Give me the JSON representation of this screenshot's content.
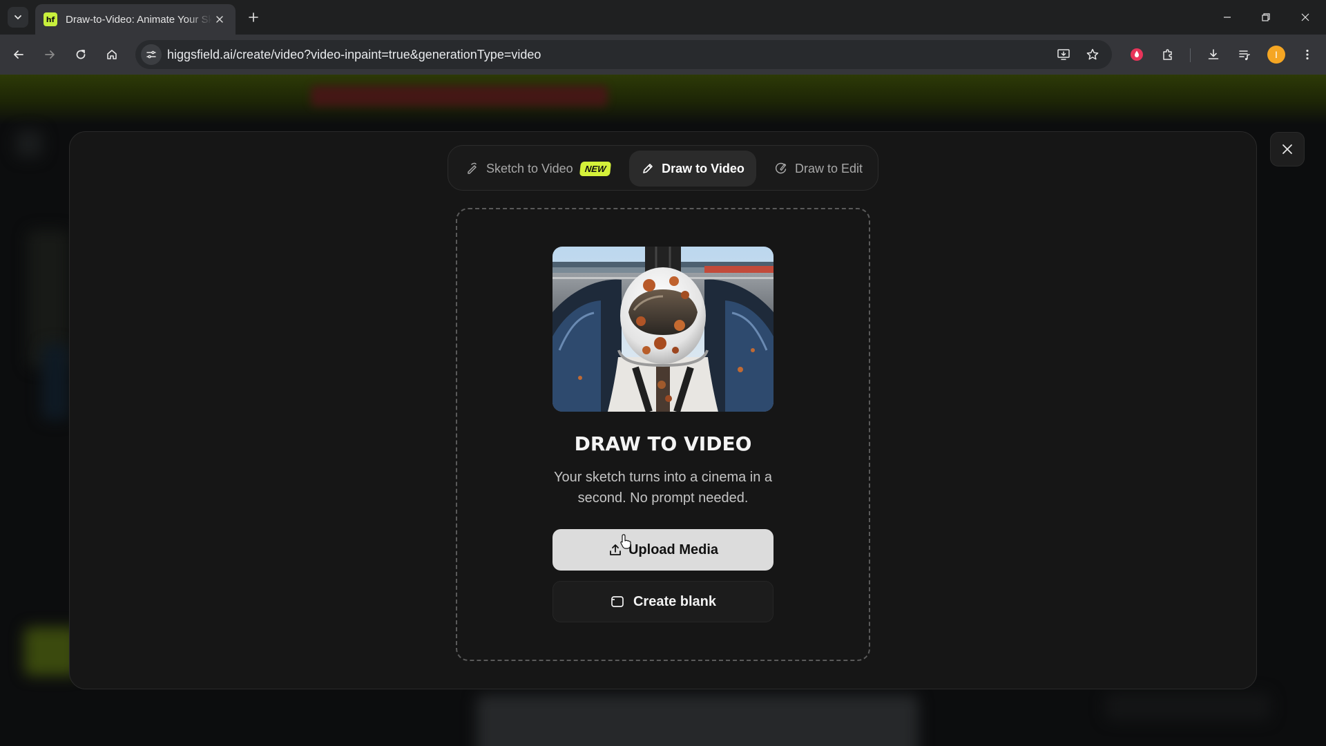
{
  "browser": {
    "tab_title": "Draw-to-Video: Animate Your Sketches",
    "favicon_label": "hf",
    "url": "higgsfield.ai/create/video?video-inpaint=true&generationType=video",
    "profile_initial": "I"
  },
  "modal": {
    "tabs": [
      {
        "label": "Sketch to Video",
        "badge": "NEW",
        "icon": "sketch-icon"
      },
      {
        "label": "Draw to Video",
        "icon": "pen-icon",
        "active": true
      },
      {
        "label": "Draw to Edit",
        "icon": "edit-brush-icon"
      }
    ],
    "title": "DRAW TO VIDEO",
    "description": "Your sketch turns into a cinema in a second. No prompt needed.",
    "upload_label": "Upload Media",
    "create_blank_label": "Create blank"
  },
  "colors": {
    "accent": "#d5f23a",
    "modal_bg": "#161616",
    "upload_bg": "#dcdcdc"
  }
}
